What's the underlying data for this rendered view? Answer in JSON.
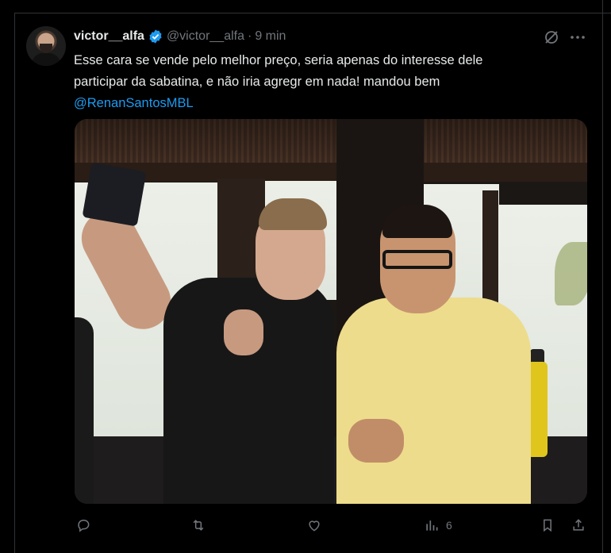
{
  "tweet": {
    "author_name": "victor__alfa",
    "handle": "@victor__alfa",
    "separator": "·",
    "time": "9 min",
    "text_line1": "Esse cara se vende pelo melhor preço, seria apenas do interesse dele",
    "text_line2": "participar da sabatina, e não iria agregr em nada! mandou bem",
    "mention": "@RenanSantosMBL"
  },
  "actions": {
    "views_count": "6"
  },
  "icons": {
    "verified": "verified-badge-icon",
    "grok": "grok-icon",
    "more": "more-icon",
    "reply": "reply-icon",
    "retweet": "retweet-icon",
    "like": "like-icon",
    "views": "views-icon",
    "bookmark": "bookmark-icon",
    "share": "share-icon"
  },
  "colors": {
    "background": "#000000",
    "text": "#e7e9ea",
    "muted": "#71767b",
    "accent": "#1d9bf0"
  }
}
